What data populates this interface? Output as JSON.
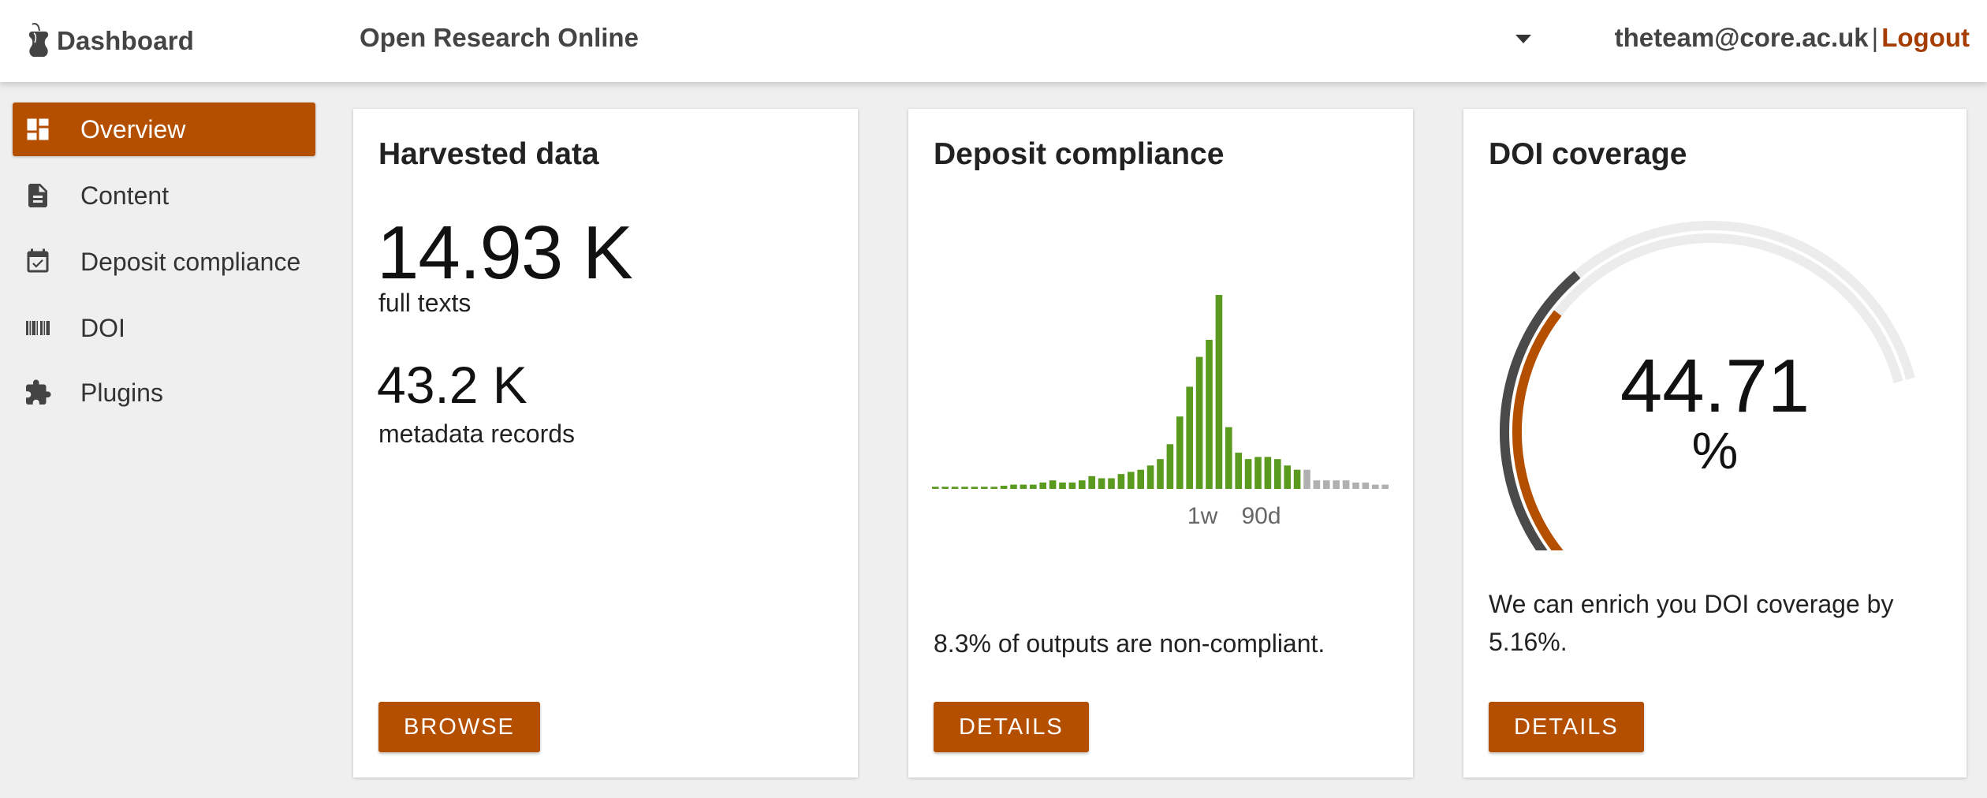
{
  "header": {
    "brand": "Dashboard",
    "repository": "Open Research Online",
    "user_email": "theteam@core.ac.uk",
    "separator": "|",
    "logout": "Logout"
  },
  "sidebar": {
    "items": [
      {
        "label": "Overview",
        "icon": "dashboard-icon",
        "active": true
      },
      {
        "label": "Content",
        "icon": "document-icon",
        "active": false
      },
      {
        "label": "Deposit compliance",
        "icon": "calendar-check-icon",
        "active": false
      },
      {
        "label": "DOI",
        "icon": "barcode-icon",
        "active": false
      },
      {
        "label": "Plugins",
        "icon": "puzzle-icon",
        "active": false
      }
    ]
  },
  "cards": {
    "harvested": {
      "title": "Harvested data",
      "fulltexts_value": "14.93 K",
      "fulltexts_label": "full texts",
      "metadata_value": "43.2 K",
      "metadata_label": "metadata records",
      "button": "BROWSE"
    },
    "compliance": {
      "title": "Deposit compliance",
      "summary": "8.3% of outputs are non-compliant.",
      "button": "DETAILS"
    },
    "doi": {
      "title": "DOI coverage",
      "value": "44.71",
      "unit": "%",
      "text": "We can enrich you DOI coverage by 5.16%.",
      "button": "DETAILS"
    }
  },
  "colors": {
    "accent": "#b54f00",
    "compliant": "#5a9a1e",
    "noncompliant": "#b0b0b0",
    "gauge_dark": "#4a4a4a",
    "gauge_track": "#ececec"
  },
  "chart_data": [
    {
      "type": "bar",
      "tick_labels": [
        "1w",
        "90d"
      ],
      "tick_positions": [
        27,
        33
      ],
      "series": [
        {
          "status": "compliant",
          "values": [
            1,
            1,
            1,
            1,
            1,
            1,
            1,
            1.5,
            2,
            2,
            2,
            3,
            4,
            3,
            3,
            4,
            6,
            5,
            5,
            7,
            8,
            9,
            11,
            14,
            21,
            34,
            48,
            62,
            70,
            100,
            29,
            17,
            14,
            15,
            15,
            14,
            11,
            9
          ]
        },
        {
          "status": "non-compliant",
          "values": [
            9,
            4,
            4,
            4,
            4,
            3,
            3,
            2,
            2
          ]
        }
      ],
      "ylim": [
        0,
        100
      ],
      "grid": false,
      "legend": "none"
    },
    {
      "type": "gauge",
      "value": 44.71,
      "secondary_value": 49.87,
      "range": [
        0,
        100
      ]
    }
  ]
}
